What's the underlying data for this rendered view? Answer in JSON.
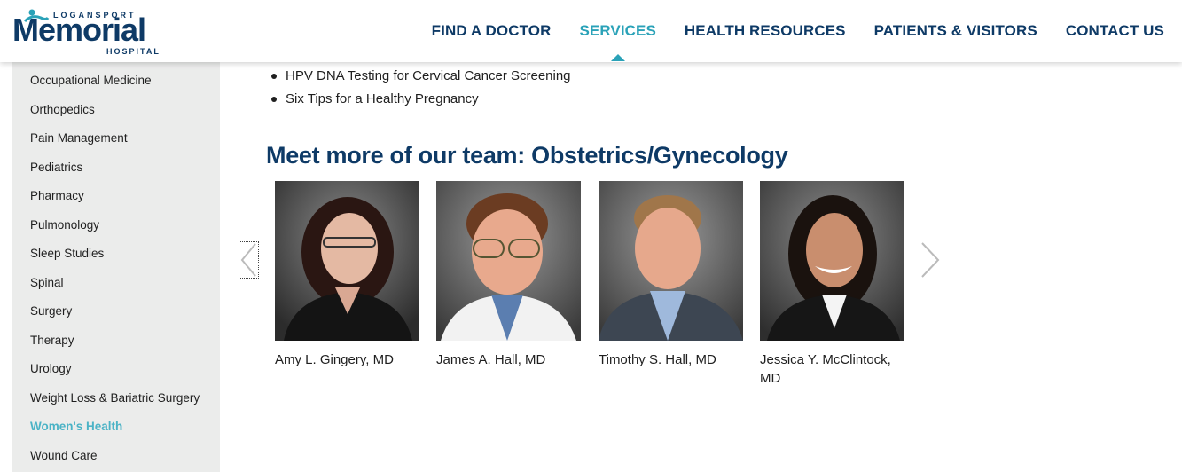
{
  "brand": {
    "logo_top": "LOGANSPORT",
    "logo_main": "Memorial",
    "logo_bottom": "HOSPITAL",
    "primary_color": "#0e3a66",
    "accent_color": "#2aa2b8"
  },
  "nav": {
    "items": [
      {
        "label": "FIND A DOCTOR"
      },
      {
        "label": "SERVICES",
        "active": true
      },
      {
        "label": "HEALTH RESOURCES"
      },
      {
        "label": "PATIENTS & VISITORS"
      },
      {
        "label": "CONTACT US"
      }
    ]
  },
  "sidebar": {
    "items": [
      {
        "label": "Occupational Medicine"
      },
      {
        "label": "Orthopedics"
      },
      {
        "label": "Pain Management"
      },
      {
        "label": "Pediatrics"
      },
      {
        "label": "Pharmacy"
      },
      {
        "label": "Pulmonology"
      },
      {
        "label": "Sleep Studies"
      },
      {
        "label": "Spinal"
      },
      {
        "label": "Surgery"
      },
      {
        "label": "Therapy"
      },
      {
        "label": "Urology"
      },
      {
        "label": "Weight Loss & Bariatric Surgery"
      },
      {
        "label": "Women's Health",
        "active": true
      },
      {
        "label": "Wound Care"
      }
    ]
  },
  "main": {
    "links": [
      {
        "label": "HPV DNA Testing for Cervical Cancer Screening"
      },
      {
        "label": "Six Tips for a Healthy Pregnancy"
      }
    ],
    "team_heading": "Meet more of our team: Obstetrics/Gynecology",
    "doctors": [
      {
        "name": "Amy L. Gingery, MD"
      },
      {
        "name": "James A. Hall, MD"
      },
      {
        "name": "Timothy S. Hall, MD"
      },
      {
        "name": "Jessica Y. McClintock, MD"
      }
    ],
    "carousel": {
      "prev_icon": "chevron-left-icon",
      "next_icon": "chevron-right-icon"
    }
  }
}
